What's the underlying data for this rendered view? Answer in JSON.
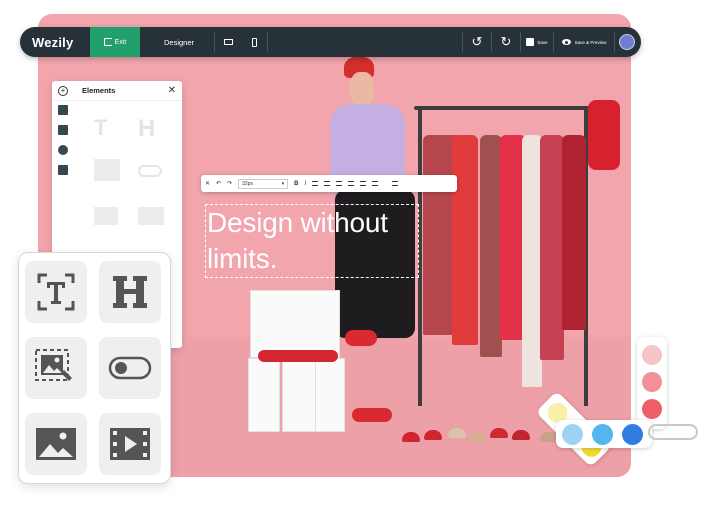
{
  "topbar": {
    "logo": "Wezily",
    "exit_label": "Exit",
    "mode_label": "Designer",
    "save_label": "Save",
    "preview_label": "Save & Preview"
  },
  "panel": {
    "title": "Elements"
  },
  "text_toolbar": {
    "font_size": "32px"
  },
  "canvas": {
    "headline_line1": "Design without",
    "headline_line2": "limits."
  },
  "icons": {
    "topbar": [
      "exit-icon",
      "desktop-icon",
      "mobile-icon",
      "undo-icon",
      "redo-icon",
      "save-icon",
      "eye-icon",
      "avatar-icon"
    ],
    "panel_rail": [
      "layout-icon",
      "section-icon",
      "palette-icon",
      "image-icon"
    ],
    "widgets": [
      "text-icon",
      "heading-icon",
      "image-edit-icon",
      "toggle-icon",
      "image-icon",
      "video-icon"
    ]
  },
  "colors": {
    "canvas_bg": "#f2a5ac",
    "topbar_bg": "#263238",
    "exit_green": "#22a06b",
    "swatch_pinks": [
      "#f6c4c8",
      "#f28f98",
      "#ee5e68"
    ],
    "swatch_yellows": [
      "#f9f0a8",
      "#f5e96b",
      "#f0dc2e"
    ],
    "swatch_blues": [
      "#9fd3f5",
      "#55b5ef",
      "#2f7de0"
    ]
  }
}
